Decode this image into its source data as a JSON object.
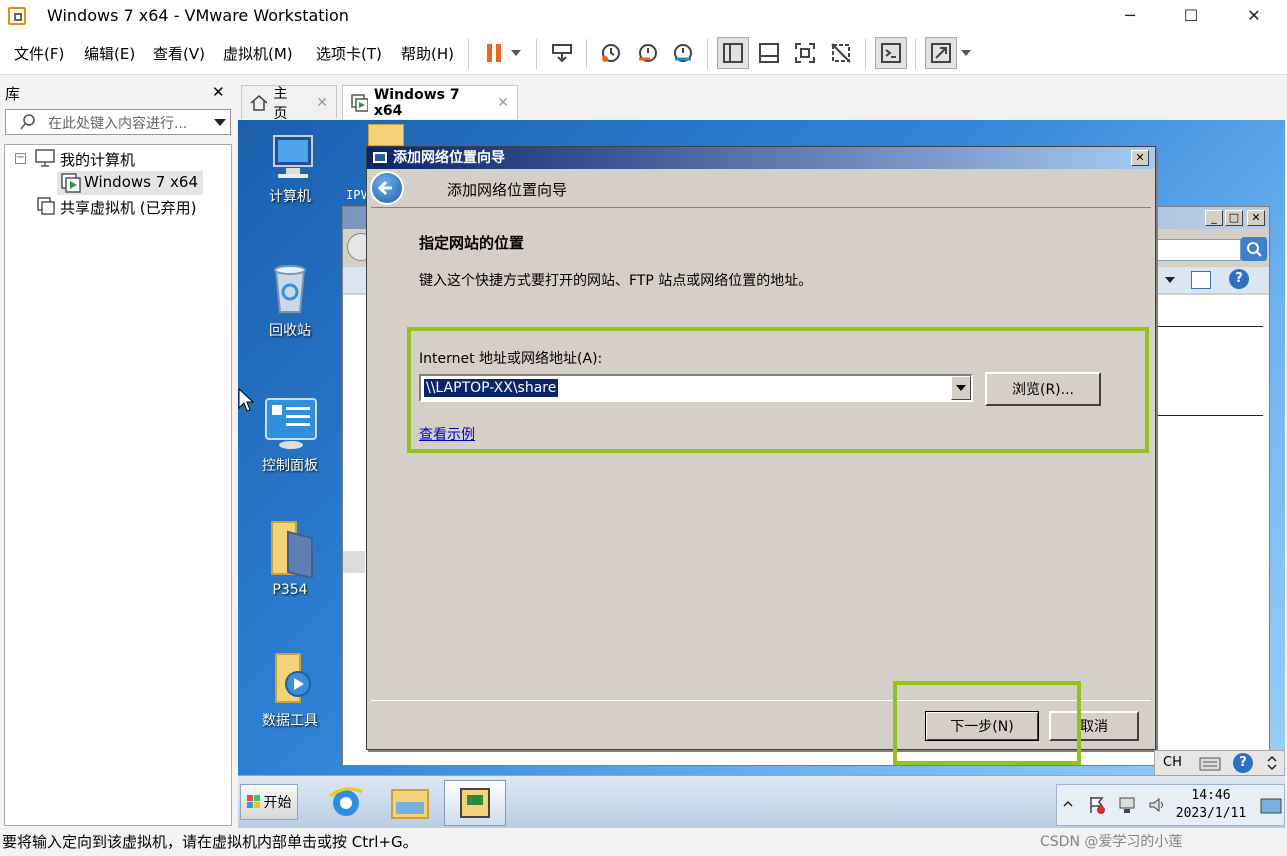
{
  "window": {
    "title": "Windows 7 x64 - VMware Workstation",
    "minimize": "─",
    "maximize": "☐",
    "close": "✕"
  },
  "menu": [
    "文件(F)",
    "编辑(E)",
    "查看(V)",
    "虚拟机(M)",
    "选项卡(T)",
    "帮助(H)"
  ],
  "library": {
    "title": "库",
    "close": "✕",
    "search_placeholder": "在此处键入内容进行...",
    "tree": {
      "root": "我的计算机",
      "vm": "Windows 7 x64",
      "shared": "共享虚拟机 (已弃用)"
    }
  },
  "tabs": [
    {
      "label": "主页"
    },
    {
      "label": "Windows 7 x64"
    }
  ],
  "desktop": {
    "icons": [
      "计算机",
      "回收站",
      "控制面板",
      "P354",
      "数据工具"
    ],
    "partial_label": "IPV"
  },
  "wizard": {
    "title": "添加网络位置向导",
    "header": "添加网络位置向导",
    "heading": "指定网站的位置",
    "description": "键入这个快捷方式要打开的网站、FTP 站点或网络位置的地址。",
    "field_label": "Internet 地址或网络地址(A):",
    "field_value": "\\\\LAPTOP-XX\\share",
    "browse": "浏览(R)...",
    "example_link": "查看示例",
    "next": "下一步(N)",
    "cancel": "取消"
  },
  "taskbar": {
    "start": "开始",
    "lang": "CH",
    "time": "14:46",
    "date": "2023/1/11"
  },
  "status": "要将输入定向到该虚拟机，请在虚拟机内部单击或按 Ctrl+G。",
  "watermark": "CSDN @爱学习的小莲",
  "colors": {
    "highlight": "#94c11f",
    "accent_pause": "#e8671c"
  }
}
